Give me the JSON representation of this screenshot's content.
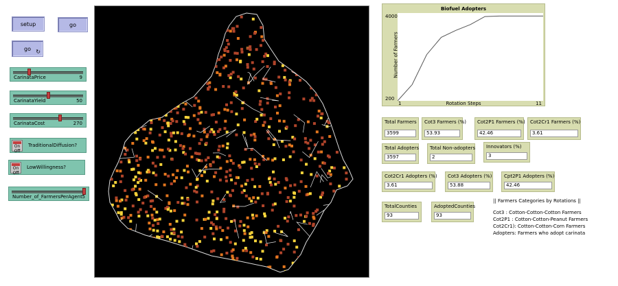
{
  "buttons": {
    "setup": "setup",
    "go_once": "go",
    "go_forever": "go",
    "forever_icon": "↻"
  },
  "sliders": [
    {
      "label": "CarinataPrice",
      "value": "9",
      "fraction": 0.22
    },
    {
      "label": "CarinataYield",
      "value": "50",
      "fraction": 0.5
    },
    {
      "label": "CarinataCost",
      "value": "270",
      "fraction": 0.68
    },
    {
      "label": "Number_of_FarmersPerAgent",
      "value": "5",
      "fraction": 1.0
    }
  ],
  "switches": [
    {
      "on": "On",
      "off": "Off",
      "label": "TraditionalDiffusion?"
    },
    {
      "on": "On",
      "off": "Off",
      "label": "LowWillingness?"
    }
  ],
  "plot": {
    "title": "Biofuel Adopters",
    "ylabel": "Number of Farmers",
    "xlabel": "Rotation Steps",
    "ymax": "4000",
    "ymin": "200",
    "xmin": "1",
    "xmax": "11"
  },
  "chart_data": {
    "type": "line",
    "x": [
      1,
      2,
      3,
      4,
      5,
      6,
      7,
      8,
      9,
      10,
      11
    ],
    "y": [
      200,
      900,
      2200,
      2950,
      3250,
      3500,
      3850,
      3870,
      3870,
      3870,
      3870
    ],
    "xlim": [
      1,
      11
    ],
    "ylim": [
      200,
      4000
    ]
  },
  "monitors": [
    {
      "label": "Total Farmers",
      "value": "3599"
    },
    {
      "label": "Cot3 Farmers (%)",
      "value": "53.93"
    },
    {
      "label": "Cot2P1 Farmers (%)",
      "value": "42.46"
    },
    {
      "label": "Cot2Cr1 Farmers (%)",
      "value": "3.61"
    },
    {
      "label": "Total Adopters",
      "value": "3597"
    },
    {
      "label": "Total Non-adopters",
      "value": "2"
    },
    {
      "label": "Innovators (%)",
      "value": "3"
    },
    {
      "label": "Cot2Cr1 Adopters (%)",
      "value": "3.61"
    },
    {
      "label": "Cot3 Adopters (%)",
      "value": "53.88"
    },
    {
      "label": "Cpt2P1 Adopters (%)",
      "value": "42.46"
    },
    {
      "label": "TotalCounties",
      "value": "93"
    },
    {
      "label": "AdoptedCounties",
      "value": "93"
    }
  ],
  "legend_notes": {
    "header": "|| Farmers Categories by Rotations ||",
    "line1": "Cot3    : Cotton-Cotton-Cotton Farmers",
    "line2": "Cot2P1  : Cotton-Cotton-Peanut Farmers",
    "line3": "Cot2Cr1): Cotton-Cotton-Corn Farmers",
    "line4": "Adopters: Farmers who adopt carinata"
  },
  "colors": {
    "world_bg": "#000000",
    "button": "#b5b9e6",
    "widget_green": "#7fc4ae",
    "monitor": "#d8ddb0",
    "patch_dark": "#b0442a",
    "patch_orange": "#e2761e",
    "patch_yellow": "#f5d23a",
    "border_line": "#e8e8e8"
  }
}
